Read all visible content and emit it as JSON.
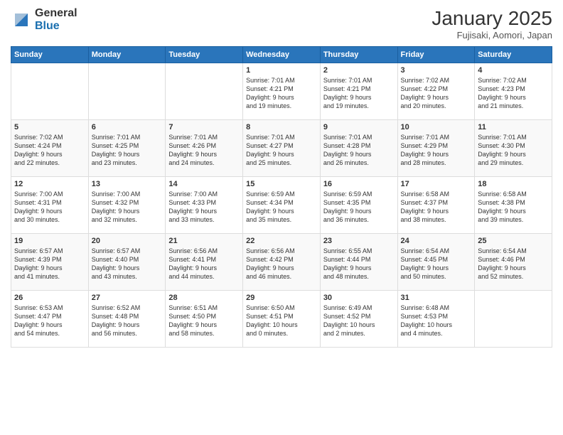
{
  "logo": {
    "general": "General",
    "blue": "Blue"
  },
  "header": {
    "month": "January 2025",
    "location": "Fujisaki, Aomori, Japan"
  },
  "weekdays": [
    "Sunday",
    "Monday",
    "Tuesday",
    "Wednesday",
    "Thursday",
    "Friday",
    "Saturday"
  ],
  "weeks": [
    [
      {
        "day": "",
        "content": ""
      },
      {
        "day": "",
        "content": ""
      },
      {
        "day": "",
        "content": ""
      },
      {
        "day": "1",
        "content": "Sunrise: 7:01 AM\nSunset: 4:21 PM\nDaylight: 9 hours\nand 19 minutes."
      },
      {
        "day": "2",
        "content": "Sunrise: 7:01 AM\nSunset: 4:21 PM\nDaylight: 9 hours\nand 19 minutes."
      },
      {
        "day": "3",
        "content": "Sunrise: 7:02 AM\nSunset: 4:22 PM\nDaylight: 9 hours\nand 20 minutes."
      },
      {
        "day": "4",
        "content": "Sunrise: 7:02 AM\nSunset: 4:23 PM\nDaylight: 9 hours\nand 21 minutes."
      }
    ],
    [
      {
        "day": "5",
        "content": "Sunrise: 7:02 AM\nSunset: 4:24 PM\nDaylight: 9 hours\nand 22 minutes."
      },
      {
        "day": "6",
        "content": "Sunrise: 7:01 AM\nSunset: 4:25 PM\nDaylight: 9 hours\nand 23 minutes."
      },
      {
        "day": "7",
        "content": "Sunrise: 7:01 AM\nSunset: 4:26 PM\nDaylight: 9 hours\nand 24 minutes."
      },
      {
        "day": "8",
        "content": "Sunrise: 7:01 AM\nSunset: 4:27 PM\nDaylight: 9 hours\nand 25 minutes."
      },
      {
        "day": "9",
        "content": "Sunrise: 7:01 AM\nSunset: 4:28 PM\nDaylight: 9 hours\nand 26 minutes."
      },
      {
        "day": "10",
        "content": "Sunrise: 7:01 AM\nSunset: 4:29 PM\nDaylight: 9 hours\nand 28 minutes."
      },
      {
        "day": "11",
        "content": "Sunrise: 7:01 AM\nSunset: 4:30 PM\nDaylight: 9 hours\nand 29 minutes."
      }
    ],
    [
      {
        "day": "12",
        "content": "Sunrise: 7:00 AM\nSunset: 4:31 PM\nDaylight: 9 hours\nand 30 minutes."
      },
      {
        "day": "13",
        "content": "Sunrise: 7:00 AM\nSunset: 4:32 PM\nDaylight: 9 hours\nand 32 minutes."
      },
      {
        "day": "14",
        "content": "Sunrise: 7:00 AM\nSunset: 4:33 PM\nDaylight: 9 hours\nand 33 minutes."
      },
      {
        "day": "15",
        "content": "Sunrise: 6:59 AM\nSunset: 4:34 PM\nDaylight: 9 hours\nand 35 minutes."
      },
      {
        "day": "16",
        "content": "Sunrise: 6:59 AM\nSunset: 4:35 PM\nDaylight: 9 hours\nand 36 minutes."
      },
      {
        "day": "17",
        "content": "Sunrise: 6:58 AM\nSunset: 4:37 PM\nDaylight: 9 hours\nand 38 minutes."
      },
      {
        "day": "18",
        "content": "Sunrise: 6:58 AM\nSunset: 4:38 PM\nDaylight: 9 hours\nand 39 minutes."
      }
    ],
    [
      {
        "day": "19",
        "content": "Sunrise: 6:57 AM\nSunset: 4:39 PM\nDaylight: 9 hours\nand 41 minutes."
      },
      {
        "day": "20",
        "content": "Sunrise: 6:57 AM\nSunset: 4:40 PM\nDaylight: 9 hours\nand 43 minutes."
      },
      {
        "day": "21",
        "content": "Sunrise: 6:56 AM\nSunset: 4:41 PM\nDaylight: 9 hours\nand 44 minutes."
      },
      {
        "day": "22",
        "content": "Sunrise: 6:56 AM\nSunset: 4:42 PM\nDaylight: 9 hours\nand 46 minutes."
      },
      {
        "day": "23",
        "content": "Sunrise: 6:55 AM\nSunset: 4:44 PM\nDaylight: 9 hours\nand 48 minutes."
      },
      {
        "day": "24",
        "content": "Sunrise: 6:54 AM\nSunset: 4:45 PM\nDaylight: 9 hours\nand 50 minutes."
      },
      {
        "day": "25",
        "content": "Sunrise: 6:54 AM\nSunset: 4:46 PM\nDaylight: 9 hours\nand 52 minutes."
      }
    ],
    [
      {
        "day": "26",
        "content": "Sunrise: 6:53 AM\nSunset: 4:47 PM\nDaylight: 9 hours\nand 54 minutes."
      },
      {
        "day": "27",
        "content": "Sunrise: 6:52 AM\nSunset: 4:48 PM\nDaylight: 9 hours\nand 56 minutes."
      },
      {
        "day": "28",
        "content": "Sunrise: 6:51 AM\nSunset: 4:50 PM\nDaylight: 9 hours\nand 58 minutes."
      },
      {
        "day": "29",
        "content": "Sunrise: 6:50 AM\nSunset: 4:51 PM\nDaylight: 10 hours\nand 0 minutes."
      },
      {
        "day": "30",
        "content": "Sunrise: 6:49 AM\nSunset: 4:52 PM\nDaylight: 10 hours\nand 2 minutes."
      },
      {
        "day": "31",
        "content": "Sunrise: 6:48 AM\nSunset: 4:53 PM\nDaylight: 10 hours\nand 4 minutes."
      },
      {
        "day": "",
        "content": ""
      }
    ]
  ]
}
